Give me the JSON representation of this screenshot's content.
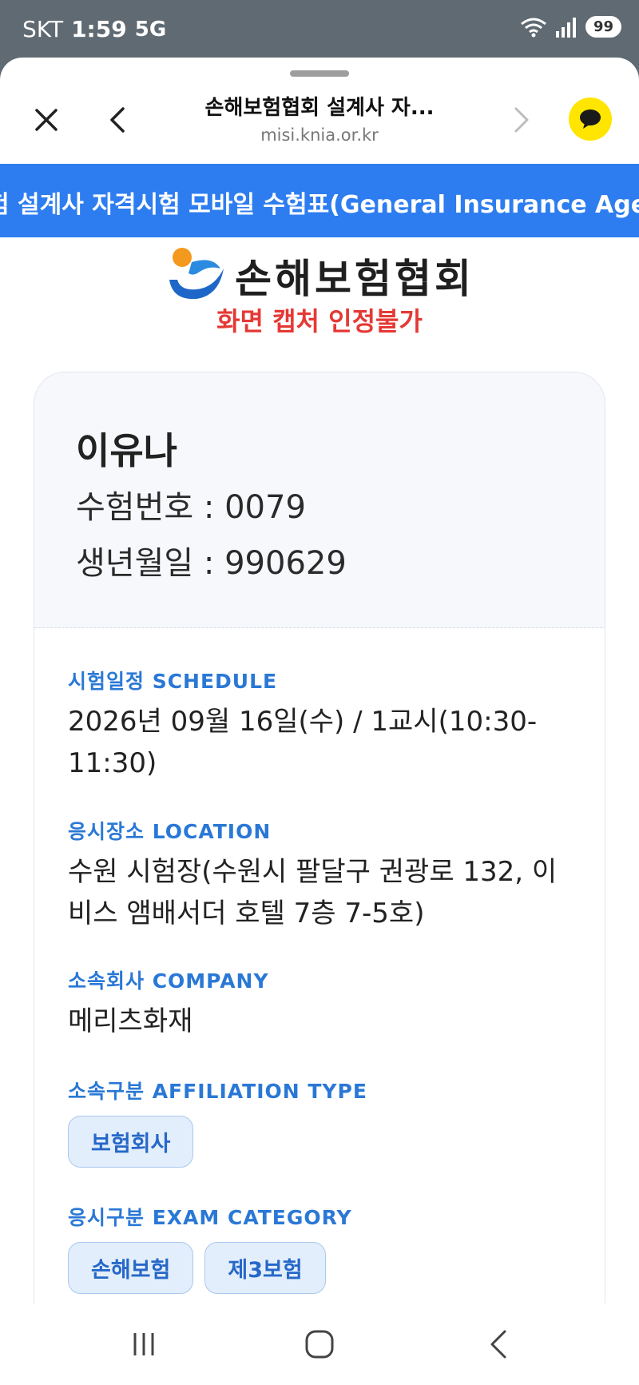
{
  "status_bar": {
    "carrier": "SKT",
    "time": "1:59",
    "network": "5G",
    "battery": "99"
  },
  "browser": {
    "title": "손해보험협회 설계사 자...",
    "url": "misi.knia.or.kr"
  },
  "marquee": {
    "text": "험 설계사 자격시험 모바일 수험표(General Insurance Agent Exa"
  },
  "logo": {
    "text": "손해보험협회"
  },
  "warning": "화면 캡처 인정불가",
  "candidate": {
    "name": "이유나",
    "exam_number": "수험번호 : 0079",
    "birth_date": "생년월일 : 990629"
  },
  "schedule": {
    "label": "시험일정 SCHEDULE",
    "value": "2026년 09월 16일(수) / 1교시(10:30-11:30)"
  },
  "location": {
    "label": "응시장소 LOCATION",
    "value": "수원 시험장(수원시 팔달구 권광로 132, 이비스 앰배서더 호텔 7층 7-5호)"
  },
  "company": {
    "label": "소속회사 COMPANY",
    "value": "메리츠화재"
  },
  "affiliation": {
    "label": "소속구분 AFFILIATION TYPE",
    "chips": [
      "보험회사"
    ]
  },
  "exam_category": {
    "label": "응시구분 EXAM CATEGORY",
    "chips": [
      "손해보험",
      "제3보험"
    ]
  },
  "colors": {
    "accent": "#2d7df0",
    "label_blue": "#2a78d6",
    "warning_red": "#e53935",
    "kakao_yellow": "#ffe500"
  }
}
